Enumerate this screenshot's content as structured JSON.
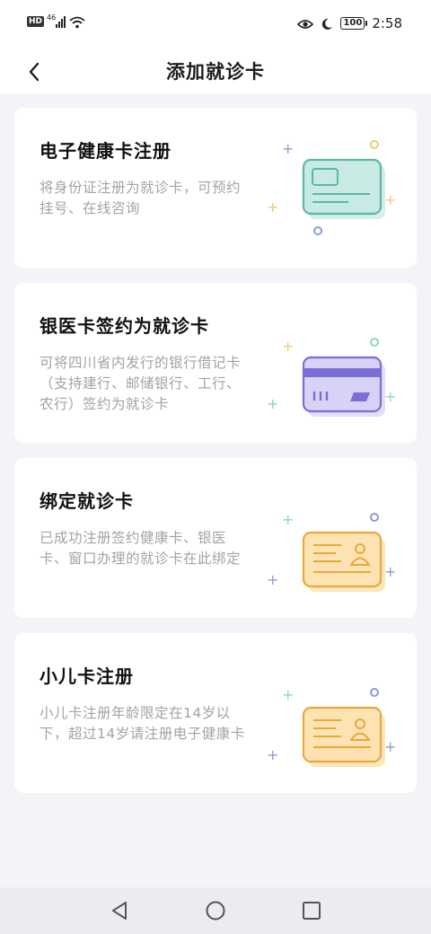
{
  "status_bar": {
    "hd": "HD",
    "network": "46",
    "battery": "100",
    "time": "2:58",
    "icons": [
      "signal-icon",
      "wifi-icon",
      "eye-icon",
      "moon-icon",
      "battery-icon"
    ]
  },
  "header": {
    "title": "添加就诊卡",
    "back_icon": "chevron-left-icon"
  },
  "cards": [
    {
      "title": "电子健康卡注册",
      "desc": "将身份证注册为就诊卡，可预约挂号、在线咨询",
      "icon": "health-card-icon",
      "color": "#5cb8a5"
    },
    {
      "title": "银医卡签约为就诊卡",
      "desc": "可将四川省内发行的银行借记卡（支持建行、邮储银行、工行、农行）签约为就诊卡",
      "icon": "bank-card-icon",
      "color": "#7b6fd6"
    },
    {
      "title": "绑定就诊卡",
      "desc": "已成功注册签约健康卡、银医卡、窗口办理的就诊卡在此绑定",
      "icon": "id-card-icon",
      "color": "#e8a83c"
    },
    {
      "title": "小儿卡注册",
      "desc": "小儿卡注册年龄限定在14岁以下，超过14岁请注册电子健康卡",
      "icon": "id-card-icon",
      "color": "#e8a83c"
    }
  ],
  "nav_bar": {
    "icons": [
      "back-triangle-icon",
      "home-circle-icon",
      "recents-square-icon"
    ]
  }
}
